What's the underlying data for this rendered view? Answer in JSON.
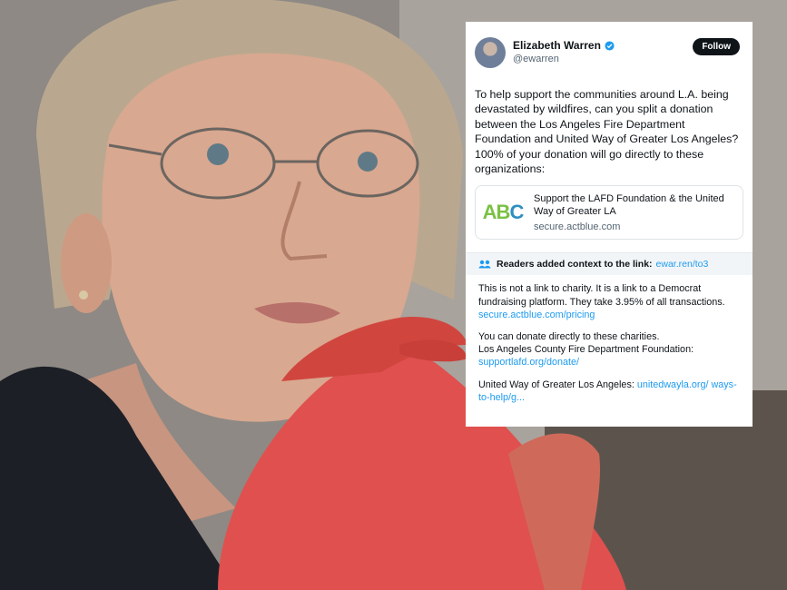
{
  "tweet": {
    "author_name": "Elizabeth Warren",
    "handle": "@ewarren",
    "follow_label": "Follow",
    "text": "To help support the communities around L.A. being devastated by wildfires, can you split a donation between the Los Angeles Fire Department Foundation and United Way of Greater Los Angeles? 100% of your donation will go directly to these organizations:",
    "link_card": {
      "logo_text_1": "AB",
      "logo_text_2": "C",
      "title": "Support the LAFD Foundation & the United Way of Greater LA",
      "domain": "secure.actblue.com"
    }
  },
  "community_note": {
    "header": "Readers added context to the link:",
    "header_link": "ewar.ren/to3",
    "para1_text": "This is not a link to charity. It is a link to a Democrat fundraising platform. They take 3.95% of all transactions.",
    "para1_link": "secure.actblue.com/pricing",
    "para2_line1": "You can donate directly to these charities.",
    "para2_line2": "Los Angeles County Fire Department Foundation:",
    "para2_link": "supportlafd.org/donate/",
    "para3_text": "United Way of Greater Los Angeles:",
    "para3_link": "unitedwayla.org/ ways-to-help/g..."
  },
  "colors": {
    "verified": "#1d9bf0",
    "link": "#1d9bf0",
    "follow_bg": "#0f1419",
    "hand_tint": "#e0504e"
  },
  "icons": {
    "verified": "verified-badge-icon",
    "readers": "people-icon"
  }
}
